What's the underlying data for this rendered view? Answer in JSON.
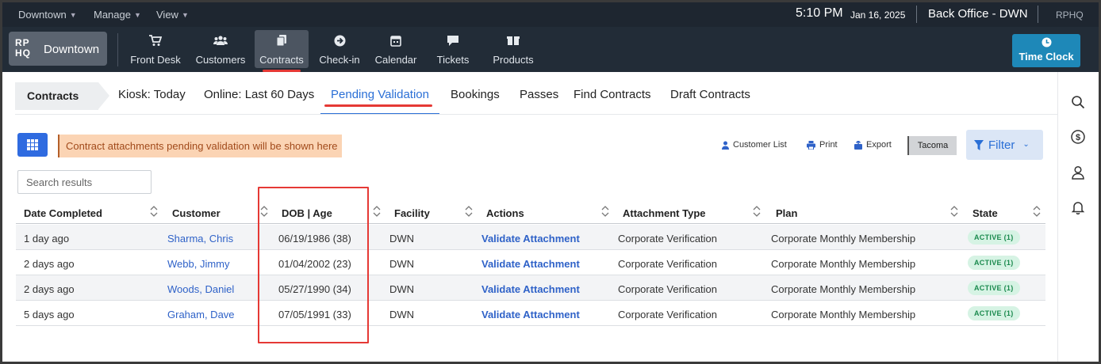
{
  "topbar": {
    "menus": [
      {
        "label": "Downtown"
      },
      {
        "label": "Manage"
      },
      {
        "label": "View"
      }
    ],
    "time": "5:10 PM",
    "date": "Jan 16, 2025",
    "office": "Back Office - DWN",
    "org": "RPHQ"
  },
  "brand": {
    "logo_top": "RP",
    "logo_bottom": "HQ",
    "name": "Downtown"
  },
  "nav": {
    "items": [
      {
        "label": "Front Desk",
        "icon": "cart-icon"
      },
      {
        "label": "Customers",
        "icon": "users-icon"
      },
      {
        "label": "Contracts",
        "icon": "contracts-icon"
      },
      {
        "label": "Check-in",
        "icon": "arrow-circle-icon"
      },
      {
        "label": "Calendar",
        "icon": "calendar-icon"
      },
      {
        "label": "Tickets",
        "icon": "chat-icon"
      },
      {
        "label": "Products",
        "icon": "boxes-icon"
      }
    ],
    "active": "Contracts",
    "time_clock": "Time Clock"
  },
  "subnav": {
    "crumb": "Contracts",
    "tabs": [
      {
        "label": "Kiosk: Today"
      },
      {
        "label": "Online: Last 60 Days"
      },
      {
        "label": "Pending Validation"
      },
      {
        "label": "Bookings"
      },
      {
        "label": "Passes"
      },
      {
        "label": "Find Contracts"
      },
      {
        "label": "Draft Contracts"
      }
    ],
    "active": "Pending Validation"
  },
  "toolbar": {
    "notice": "Contract attachments pending validation will be shown here",
    "customer_list": "Customer List",
    "print": "Print",
    "export": "Export",
    "location": "Tacoma",
    "filter": "Filter"
  },
  "search": {
    "placeholder": "Search results"
  },
  "table": {
    "columns": [
      "Date Completed",
      "Customer",
      "DOB | Age",
      "Facility",
      "Actions",
      "Attachment Type",
      "Plan",
      "State"
    ],
    "rows": [
      {
        "date": "1 day ago",
        "customer": "Sharma, Chris",
        "dob": "06/19/1986 (38)",
        "facility": "DWN",
        "action": "Validate Attachment",
        "type": "Corporate Verification",
        "plan": "Corporate Monthly Membership",
        "state": "ACTIVE (1)"
      },
      {
        "date": "2 days ago",
        "customer": "Webb, Jimmy",
        "dob": "01/04/2002 (23)",
        "facility": "DWN",
        "action": "Validate Attachment",
        "type": "Corporate Verification",
        "plan": "Corporate Monthly Membership",
        "state": "ACTIVE (1)"
      },
      {
        "date": "2 days ago",
        "customer": "Woods, Daniel",
        "dob": "05/27/1990 (34)",
        "facility": "DWN",
        "action": "Validate Attachment",
        "type": "Corporate Verification",
        "plan": "Corporate Monthly Membership",
        "state": "ACTIVE (1)"
      },
      {
        "date": "5 days ago",
        "customer": "Graham, Dave",
        "dob": "07/05/1991 (33)",
        "facility": "DWN",
        "action": "Validate Attachment",
        "type": "Corporate Verification",
        "plan": "Corporate Monthly Membership",
        "state": "ACTIVE (1)"
      }
    ]
  },
  "rail": {
    "icons": [
      "search-icon",
      "dollar-icon",
      "user-icon",
      "bell-icon"
    ]
  },
  "colors": {
    "accent": "#2a6fd6",
    "highlight": "#e53935",
    "nav_bg": "#222c37",
    "active_badge": "#1b8a4e"
  }
}
